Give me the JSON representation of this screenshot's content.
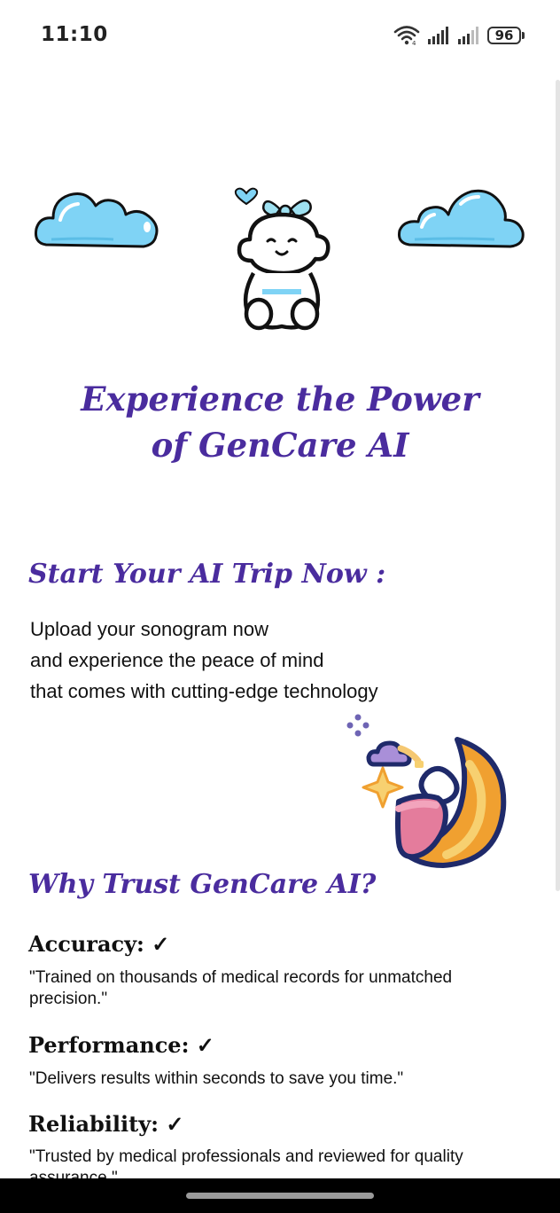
{
  "status_bar": {
    "time": "11:10",
    "battery": "96",
    "icons": [
      "wifi-icon",
      "signal-icon",
      "signal-icon",
      "battery-icon"
    ]
  },
  "hero": {
    "title_line1": "Experience the Power",
    "title_line2": "of GenCare AI",
    "icons": [
      "cloud-icon",
      "baby-icon",
      "cloud-icon"
    ]
  },
  "start_section": {
    "title": "Start Your AI Trip Now :",
    "body_lines": [
      "Upload your sonogram now",
      "and experience the peace of mind",
      "that comes with cutting-edge technology"
    ],
    "icon": "moon-baby-icon"
  },
  "trust_section": {
    "title": "Why Trust GenCare AI?",
    "features": [
      {
        "title": "Accuracy: ✓",
        "desc": "\"Trained on thousands of medical records for unmatched precision.\""
      },
      {
        "title": "Performance: ✓",
        "desc": "\"Delivers results within seconds to save you time.\""
      },
      {
        "title": "Reliability: ✓",
        "desc": "\"Trusted by medical professionals and reviewed for quality assurance.\""
      }
    ]
  },
  "colors": {
    "accent": "#4a2c9e",
    "cloud": "#7fd3f5",
    "outline": "#111111",
    "navbar": "#000000"
  }
}
